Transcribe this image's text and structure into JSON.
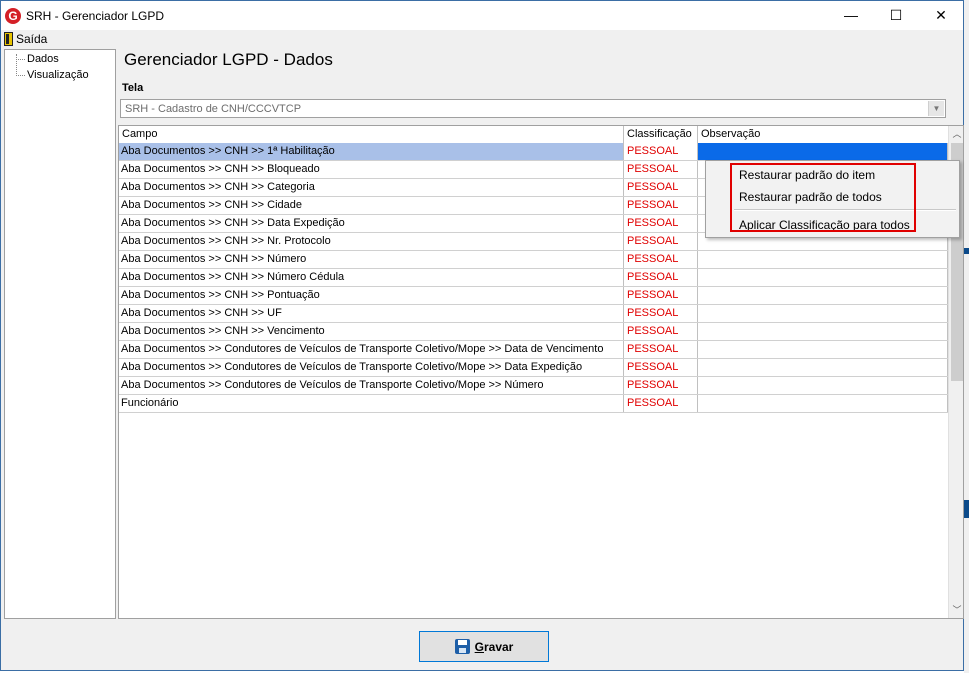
{
  "window": {
    "title": "SRH - Gerenciador LGPD",
    "app_icon_letter": "G",
    "minimize_glyph": "—",
    "maximize_glyph": "☐",
    "close_glyph": "✕"
  },
  "menu": {
    "exit_label": "Saída"
  },
  "tree": {
    "items": [
      "Dados",
      "Visualização"
    ]
  },
  "page": {
    "title": "Gerenciador LGPD - Dados",
    "screen_label": "Tela",
    "screen_value": "SRH - Cadastro de CNH/CCCVTCP"
  },
  "grid": {
    "columns": [
      "Campo",
      "Classificação",
      "Observação"
    ],
    "rows": [
      {
        "campo": "Aba Documentos >> CNH >> 1ª Habilitação",
        "classificacao": "PESSOAL",
        "observacao": ""
      },
      {
        "campo": "Aba Documentos >> CNH >> Bloqueado",
        "classificacao": "PESSOAL",
        "observacao": ""
      },
      {
        "campo": "Aba Documentos >> CNH >> Categoria",
        "classificacao": "PESSOAL",
        "observacao": ""
      },
      {
        "campo": "Aba Documentos >> CNH >> Cidade",
        "classificacao": "PESSOAL",
        "observacao": ""
      },
      {
        "campo": "Aba Documentos >> CNH >> Data Expedição",
        "classificacao": "PESSOAL",
        "observacao": ""
      },
      {
        "campo": "Aba Documentos >> CNH >> Nr. Protocolo",
        "classificacao": "PESSOAL",
        "observacao": ""
      },
      {
        "campo": "Aba Documentos >> CNH >> Número",
        "classificacao": "PESSOAL",
        "observacao": ""
      },
      {
        "campo": "Aba Documentos >> CNH >> Número Cédula",
        "classificacao": "PESSOAL",
        "observacao": ""
      },
      {
        "campo": "Aba Documentos >> CNH >> Pontuação",
        "classificacao": "PESSOAL",
        "observacao": ""
      },
      {
        "campo": "Aba Documentos >> CNH >> UF",
        "classificacao": "PESSOAL",
        "observacao": ""
      },
      {
        "campo": "Aba Documentos >> CNH >> Vencimento",
        "classificacao": "PESSOAL",
        "observacao": ""
      },
      {
        "campo": "Aba Documentos >> Condutores de Veículos de Transporte Coletivo/Mope >> Data de Vencimento",
        "classificacao": "PESSOAL",
        "observacao": ""
      },
      {
        "campo": "Aba Documentos >> Condutores de Veículos de Transporte Coletivo/Mope >> Data Expedição",
        "classificacao": "PESSOAL",
        "observacao": ""
      },
      {
        "campo": "Aba Documentos >> Condutores de Veículos de Transporte Coletivo/Mope >> Número",
        "classificacao": "PESSOAL",
        "observacao": ""
      },
      {
        "campo": "Funcionário",
        "classificacao": "PESSOAL",
        "observacao": ""
      }
    ]
  },
  "context_menu": {
    "items": [
      "Restaurar padrão do item",
      "Restaurar padrão de todos",
      "Aplicar Classificação para todos"
    ]
  },
  "footer": {
    "save_label_first": "G",
    "save_label_rest": "ravar"
  },
  "colors": {
    "classification_text": "#e00000",
    "selection": "#a9c0e8",
    "highlight_box": "#e00000"
  }
}
